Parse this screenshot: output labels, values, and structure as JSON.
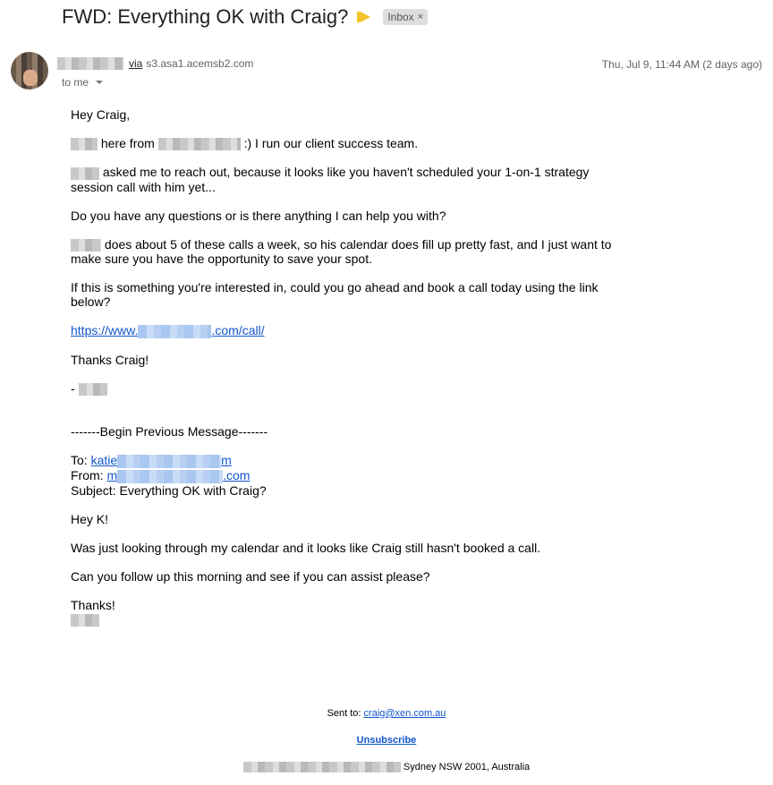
{
  "header": {
    "subject": "FWD: Everything OK with Craig?",
    "label": "Inbox",
    "label_remove": "×"
  },
  "sender": {
    "via_label": "via",
    "via_domain": "s3.asa1.acemsb2.com",
    "date": "Thu, Jul 9, 11:44 AM (2 days ago)",
    "recipient": "to me"
  },
  "body": {
    "greeting": "Hey Craig,",
    "line1": "here from",
    "line1b": ":) I run our client success team.",
    "line2": "asked me to reach out, because it looks like you haven't scheduled your 1-on-1 strategy session call with him yet...",
    "line3": "Do you have any questions or is there anything I can help you with?",
    "line4": "does about 5 of these calls a week, so his calendar does fill up pretty fast, and I just want to make sure you have the opportunity to save your spot.",
    "line5": "If this is something you're interested in, could you go ahead and book a call today using the link below?",
    "link_prefix": "https://www.",
    "link_suffix": ".com/call/",
    "thanks": "Thanks Craig!",
    "signoff": "- ",
    "prev_header": "-------Begin Previous Message-------",
    "to_label": "To:",
    "to_prefix": "katie",
    "to_suffix": "m",
    "from_label": "From:",
    "from_prefix": "m",
    "from_suffix": ".com",
    "subject_line": "Subject: Everything OK with Craig?",
    "hey_k": "Hey K!",
    "calendar": "Was just looking through my calendar and it looks like Craig still hasn't booked a call.",
    "follow_up": "Can you follow up this morning and see if you can assist please?",
    "thanks2": "Thanks!"
  },
  "footer": {
    "sent_to_label": "Sent to:",
    "sent_to_email": "craig@xen.com.au",
    "unsubscribe": "Unsubscribe",
    "address": "Sydney NSW 2001, Australia"
  },
  "colors": {
    "link": "#1155cc",
    "importance": "#f4c430",
    "label_bg": "#dddddd"
  }
}
